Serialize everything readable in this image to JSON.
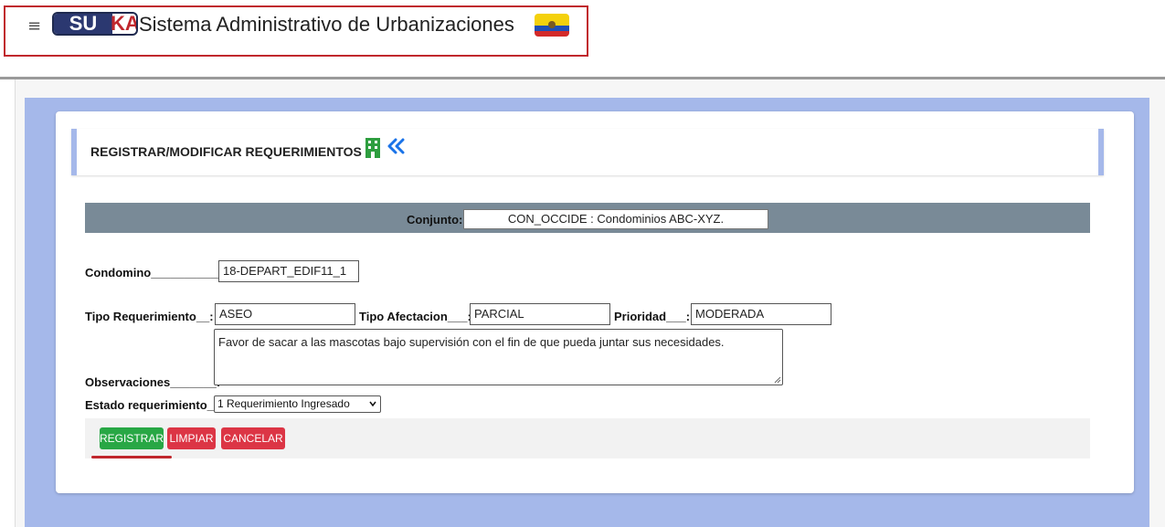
{
  "header": {
    "menu_icon": "hamburger-icon",
    "logo": {
      "part1": "SU",
      "part2": "KA"
    },
    "title": "Sistema Administrativo de Urbanizaciones",
    "flag_icon": "ecuador-flag-icon"
  },
  "page": {
    "title": "REGISTRAR/MODIFICAR REQUERIMIENTOS",
    "building_icon": "building-icon",
    "back_icon": "double-chevron-left-icon"
  },
  "form": {
    "conjunto_label": "Conjunto:",
    "conjunto_value": "CON_OCCIDE : Condominios ABC-XYZ.",
    "condominio_label": "Condomino___________:",
    "condominio_value": "18-DEPART_EDIF11_1",
    "tipo_req_label": "Tipo Requerimiento__:",
    "tipo_req_value": "ASEO",
    "tipo_afect_label": "Tipo Afectacion___:",
    "tipo_afect_value": "PARCIAL",
    "prioridad_label": "Prioridad___:",
    "prioridad_value": "MODERADA",
    "observaciones_label": "Observaciones_______:",
    "observaciones_value": "Favor de sacar a las mascotas bajo supervisión con el fin de que pueda juntar sus necesidades.",
    "estado_label": "Estado requerimiento_:",
    "estado_value": "1 Requerimiento Ingresado"
  },
  "buttons": {
    "registrar": "REGISTRAR",
    "limpiar": "LIMPIAR",
    "cancelar": "CANCELAR"
  },
  "colors": {
    "accent_blue": "#a5b8ea",
    "success": "#28a745",
    "danger": "#dc3545",
    "highlight_red": "#c0272d"
  }
}
